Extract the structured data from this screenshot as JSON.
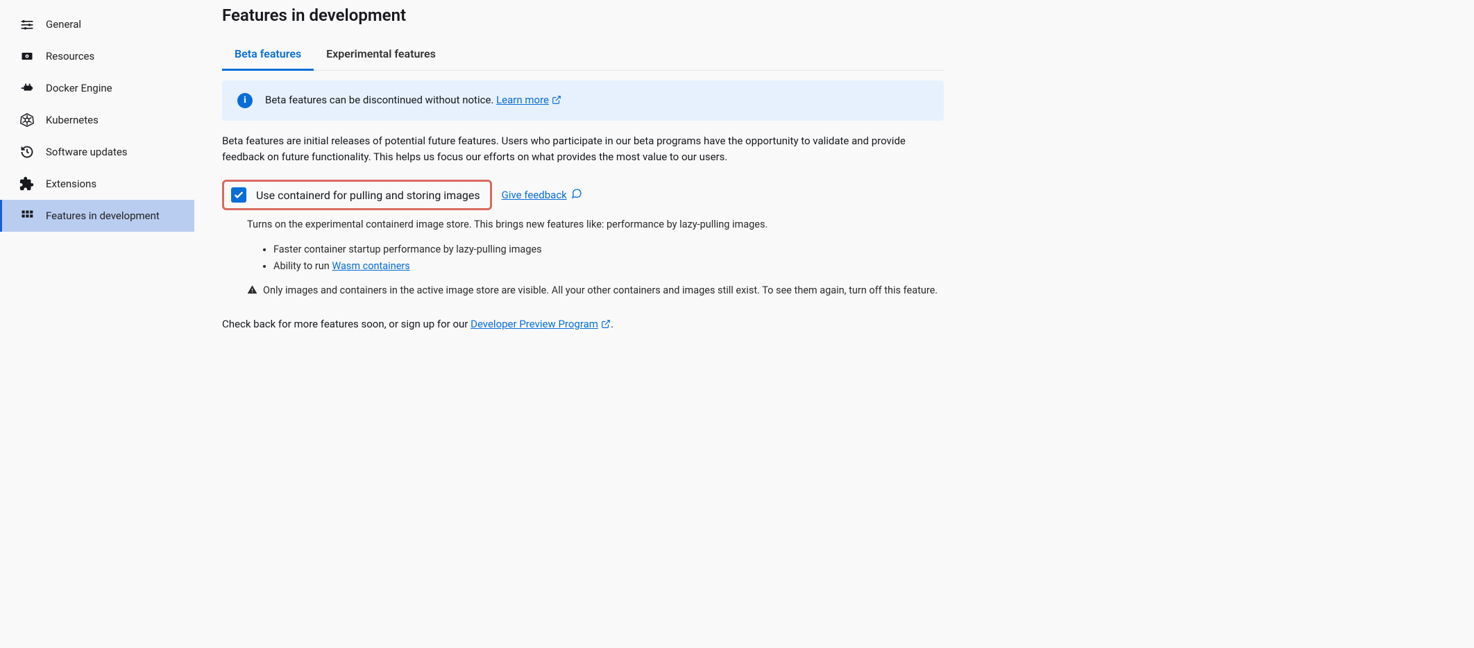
{
  "sidebar": {
    "items": [
      {
        "label": "General",
        "icon": "sliders-icon"
      },
      {
        "label": "Resources",
        "icon": "disk-icon"
      },
      {
        "label": "Docker Engine",
        "icon": "engine-icon"
      },
      {
        "label": "Kubernetes",
        "icon": "helm-icon"
      },
      {
        "label": "Software updates",
        "icon": "history-icon"
      },
      {
        "label": "Extensions",
        "icon": "puzzle-icon"
      },
      {
        "label": "Features in development",
        "icon": "grid-icon"
      }
    ],
    "active_index": 6
  },
  "page": {
    "title": "Features in development",
    "tabs": [
      "Beta features",
      "Experimental features"
    ],
    "active_tab": 0,
    "banner": {
      "text": "Beta features can be discontinued without notice. ",
      "link_text": "Learn more"
    },
    "intro": "Beta features are initial releases of potential future features. Users who participate in our beta programs have the opportunity to validate and provide feedback on future functionality. This helps us focus our efforts on what provides the most value to our users.",
    "feature": {
      "label": "Use containerd for pulling and storing images",
      "checked": true,
      "feedback": "Give feedback",
      "desc": "Turns on the experimental containerd image store. This brings new features like: performance by lazy-pulling images.",
      "bullets_prefix": [
        "Faster container startup performance by lazy-pulling images",
        "Ability to run "
      ],
      "wasm_link": "Wasm containers",
      "warning": "Only images and containers in the active image store are visible. All your other containers and images still exist. To see them again, turn off this feature."
    },
    "footer_prefix": "Check back for more features soon, or sign up for our ",
    "footer_link": "Developer Preview Program",
    "footer_suffix": "."
  }
}
